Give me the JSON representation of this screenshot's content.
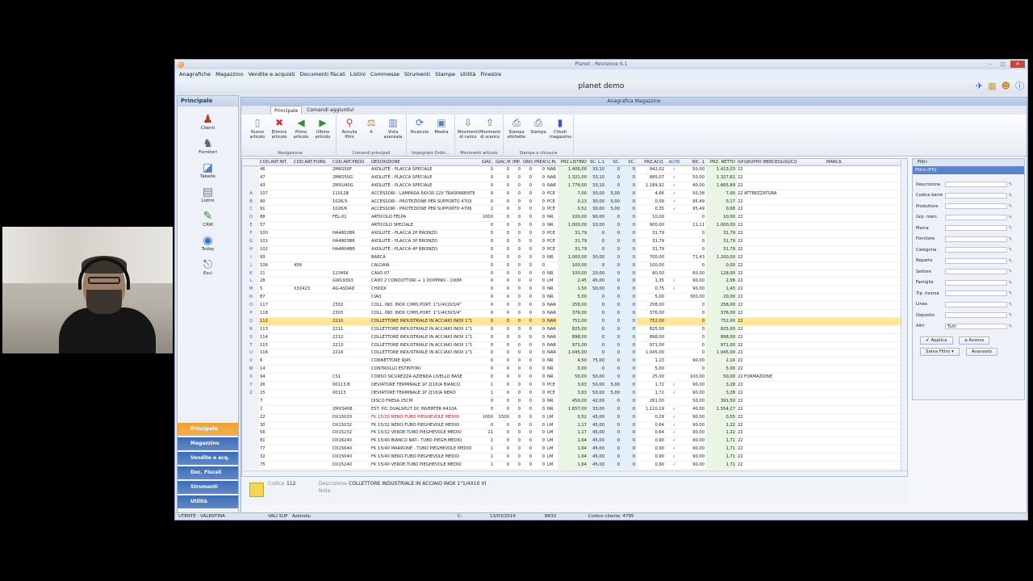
{
  "app": {
    "title": "Planet - Revisione 6.1",
    "company": "planet demo"
  },
  "menu": [
    "Anagrafiche",
    "Magazzino",
    "Vendite e acquisti",
    "Documenti fiscali",
    "Listini",
    "Commesse",
    "Strumenti",
    "Stampe",
    "Utilità",
    "Finestre"
  ],
  "sidebar": {
    "title": "Principale",
    "items": [
      {
        "label": "Clienti",
        "icon": "users-icon"
      },
      {
        "label": "Fornitori",
        "icon": "supplier-icon"
      },
      {
        "label": "Tabelle",
        "icon": "table-icon"
      },
      {
        "label": "Listini",
        "icon": "pricelist-icon"
      },
      {
        "label": "CRM",
        "icon": "crm-icon"
      },
      {
        "label": "Today",
        "icon": "globe-icon"
      },
      {
        "label": "Esci",
        "icon": "exit-icon"
      }
    ],
    "nav": [
      {
        "label": "Principale",
        "color": "#f0a030"
      },
      {
        "label": "Magazzino",
        "color": "#3d6db8"
      },
      {
        "label": "Vendite e acq.",
        "color": "#3d6db8"
      },
      {
        "label": "Doc. Fiscali",
        "color": "#3d6db8"
      },
      {
        "label": "Strumenti",
        "color": "#3d6db8"
      },
      {
        "label": "Utilità",
        "color": "#3d6db8"
      }
    ]
  },
  "panel": {
    "title": "Anagrafica Magazzino",
    "tabs": [
      "Principale",
      "Comandi aggiuntivi"
    ]
  },
  "ribbon": {
    "groups": [
      {
        "label": "Navigazione",
        "buttons": [
          "Nuovo articolo",
          "Elimina articolo",
          "Primo articolo",
          "Ultimo articolo"
        ]
      },
      {
        "label": "Comandi principali",
        "buttons": [
          "Annulla filtro",
          "A",
          "Vista avanzata"
        ]
      },
      {
        "label": "Impegnato Ordin...",
        "buttons": [
          "Ricalcola",
          "Mostra"
        ]
      },
      {
        "label": "Movimenti articolo",
        "buttons": [
          "Movimenti di carico",
          "Movimenti di scarico"
        ]
      },
      {
        "label": "Stampa e chiusura",
        "buttons": [
          "Stampa etichette",
          "Stampa",
          "Chiudi magazzino"
        ]
      }
    ]
  },
  "grid": {
    "columns": [
      "COD.ART.INT.",
      "COD.ART.FORN.",
      "COD.ART.PROD.",
      "DESCRIZIONE",
      "GIAC.",
      "GIAC.MIN.",
      "IMP.",
      "ORD.",
      "PREAS.",
      "U.M.",
      "PRZ.LISTINO",
      "SC. L.1",
      "SC. L.2",
      "SC. L.3",
      "PRZ.ACQ.",
      "ALTRI FORN.",
      "RIC. 1",
      "PRZ. NETTO 1",
      "IVA",
      "GRUPPO MERCEOLOGICO",
      "MARCA"
    ],
    "rows": [
      [
        "46",
        "",
        "2MKS50F",
        "AXOLUTE - PLACCA SPECIALE",
        "0",
        "0",
        "0",
        "0",
        "0",
        "NAR",
        "1.406,00",
        "33,10",
        "0",
        "0",
        "942,02",
        "✓",
        "50,00",
        "1.413,03",
        "22",
        ""
      ],
      [
        "47",
        "",
        "2MKS50G",
        "AXOLUTE - PLACCA SPECIALE",
        "0",
        "0",
        "0",
        "0",
        "0",
        "NAR",
        "1.321,00",
        "33,10",
        "0",
        "0",
        "885,07",
        "✓",
        "50,00",
        "1.327,61",
        "22",
        ""
      ],
      [
        "43",
        "",
        "2MXU40G",
        "AXOLUTE - PLACCA SPECIALE",
        "0",
        "0",
        "0",
        "0",
        "0",
        "NAR",
        "1.776,00",
        "33,10",
        "0",
        "0",
        "1.189,92",
        "✓",
        "40,00",
        "1.665,89",
        "22",
        ""
      ],
      [
        "107",
        "",
        "11012B",
        "ACCESSORI - LAMPADA 56X30 12V TRASPARENTE",
        "0",
        "0",
        "0",
        "0",
        "0",
        "PCE",
        "7,00",
        "30,00",
        "5,00",
        "0",
        "4,66",
        "✓",
        "50,38",
        "7,00",
        "22",
        "ATTREZZATURA"
      ],
      [
        "90",
        "",
        "1026/3",
        "ACCESSORI - PROTEZIONE PER SUPPORTO 4703",
        "0",
        "0",
        "0",
        "0",
        "0",
        "PCE",
        "0,13",
        "30,00",
        "5,00",
        "0",
        "0,09",
        "✓",
        "95,49",
        "0,17",
        "22",
        ""
      ],
      [
        "91",
        "",
        "1026/6",
        "ACCESSORI - PROTEZIONE PER SUPPORTO 4706",
        "2",
        "0",
        "0",
        "0",
        "0",
        "PCE",
        "0,52",
        "30,00",
        "5,00",
        "0",
        "0,35",
        "✓",
        "95,49",
        "0,68",
        "22",
        ""
      ],
      [
        "88",
        "",
        "FEL-01",
        "ARTICOLO FELPA",
        "1000",
        "0",
        "0",
        "0",
        "0",
        "NR.",
        "100,00",
        "90,00",
        "0",
        "0",
        "10,00",
        "",
        "0",
        "10,00",
        "22",
        ""
      ],
      [
        "57",
        "",
        "",
        "ARTICOLO SPECIALE",
        "0",
        "0",
        "0",
        "0",
        "0",
        "NR.",
        "1.000,00",
        "10,00",
        "0",
        "0",
        "900,00",
        "",
        "11,11",
        "1.000,00",
        "22",
        ""
      ],
      [
        "100",
        "",
        "HA4802BR",
        "AXOLUTE - PLACCA 2P BRONZO",
        "0",
        "0",
        "0",
        "0",
        "0",
        "PCE",
        "31,79",
        "0",
        "0",
        "0",
        "31,79",
        "",
        "0",
        "31,79",
        "22",
        ""
      ],
      [
        "101",
        "",
        "HA4803BR",
        "AXOLUTE - PLACCA 3P BRONZO",
        "0",
        "0",
        "0",
        "0",
        "0",
        "PCE",
        "31,79",
        "0",
        "0",
        "0",
        "31,79",
        "",
        "0",
        "31,79",
        "22",
        ""
      ],
      [
        "102",
        "",
        "HA4804BR",
        "AXOLUTE - PLACCA 4P BRONZO",
        "0",
        "0",
        "0",
        "0",
        "0",
        "PCE",
        "31,79",
        "0",
        "0",
        "0",
        "31,79",
        "",
        "0",
        "31,79",
        "22",
        ""
      ],
      [
        "93",
        "",
        "",
        "BARCA",
        "0",
        "0",
        "0",
        "0",
        "0",
        "NR.",
        "1.000,00",
        "30,00",
        "0",
        "0",
        "700,00",
        "",
        "71,43",
        "1.200,00",
        "22",
        ""
      ],
      [
        "106",
        "456",
        "",
        "CALDAIA",
        "0",
        "0",
        "0",
        "0",
        "0",
        "",
        "100,00",
        "0",
        "0",
        "0",
        "100,00",
        "",
        "0",
        "0,00",
        "22",
        ""
      ],
      [
        "21",
        "",
        "123456",
        "CAVO 07",
        "0",
        "0",
        "0",
        "0",
        "0",
        "NR.",
        "100,00",
        "20,00",
        "0",
        "0",
        "80,00",
        "",
        "60,00",
        "128,00",
        "22",
        ""
      ],
      [
        "28",
        "",
        "GW19393",
        "CAVO 2 CONDUTTORI + 1 DOPPINO - 100M",
        "0",
        "0",
        "0",
        "0",
        "0",
        "LM",
        "2,45",
        "45,00",
        "0",
        "0",
        "1,35",
        "✓",
        "90,00",
        "2,56",
        "22",
        ""
      ],
      [
        "5",
        "X32423",
        "AG-ASDAD",
        "CHIODI",
        "0",
        "0",
        "0",
        "0",
        "0",
        "NR.",
        "1,50",
        "50,00",
        "0",
        "0",
        "0,75",
        "✓",
        "90,00",
        "1,43",
        "22",
        ""
      ],
      [
        "87",
        "",
        "",
        "CIAO",
        "0",
        "0",
        "0",
        "0",
        "0",
        "NR.",
        "5,00",
        "0",
        "0",
        "0",
        "5,00",
        "",
        "300,00",
        "20,00",
        "22",
        ""
      ],
      [
        "117",
        "",
        "2302",
        "COLL. IND. INOX C/MIS.PORT. 1\"1/4X2X3/4\"",
        "0",
        "0",
        "0",
        "0",
        "0",
        "NAR",
        "258,00",
        "0",
        "0",
        "0",
        "258,00",
        "",
        "0",
        "258,00",
        "22",
        ""
      ],
      [
        "118",
        "",
        "2303",
        "COLL. IND. INOX C/MIS.PORT. 1\"1/4X3X3/4\"",
        "0",
        "0",
        "0",
        "0",
        "0",
        "NAR",
        "376,00",
        "0",
        "0",
        "0",
        "376,00",
        "",
        "0",
        "376,00",
        "22",
        ""
      ],
      [
        "112",
        "",
        "2210",
        "COLLETTORE INDUSTRIALE IN ACCIAIO INOX 1\"1",
        "0",
        "0",
        "0",
        "0",
        "0",
        "NAR",
        "752,00",
        "0",
        "0",
        "0",
        "752,00",
        "",
        "0",
        "752,00",
        "22",
        ""
      ],
      [
        "113",
        "",
        "2211",
        "COLLETTORE INDUSTRIALE IN ACCIAIO INOX 1\"1",
        "0",
        "0",
        "0",
        "0",
        "0",
        "NAR",
        "825,00",
        "0",
        "0",
        "0",
        "825,00",
        "",
        "0",
        "825,00",
        "22",
        ""
      ],
      [
        "114",
        "",
        "2212",
        "COLLETTORE INDUSTRIALE IN ACCIAIO INOX 1\"1",
        "0",
        "0",
        "0",
        "0",
        "0",
        "NAR",
        "898,00",
        "0",
        "0",
        "0",
        "898,00",
        "",
        "0",
        "898,00",
        "22",
        ""
      ],
      [
        "115",
        "",
        "2213",
        "COLLETTORE INDUSTRIALE IN ACCIAIO INOX 1\"1",
        "0",
        "0",
        "0",
        "0",
        "0",
        "NAR",
        "971,00",
        "0",
        "0",
        "0",
        "971,00",
        "",
        "0",
        "971,00",
        "22",
        ""
      ],
      [
        "116",
        "",
        "2214",
        "COLLETTORE INDUSTRIALE IN ACCIAIO INOX 1\"1",
        "0",
        "0",
        "0",
        "0",
        "0",
        "NAR",
        "1.045,00",
        "0",
        "0",
        "0",
        "1.045,00",
        "",
        "0",
        "1.045,00",
        "22",
        ""
      ],
      [
        "6",
        "",
        "",
        "CONNETTORE RJ45",
        "0",
        "0",
        "0",
        "0",
        "0",
        "NR.",
        "4,50",
        "75,00",
        "0",
        "0",
        "1,13",
        "",
        "90,00",
        "2,14",
        "22",
        ""
      ],
      [
        "14",
        "",
        "",
        "CONTROLLO ESTINTORI",
        "0",
        "0",
        "0",
        "0",
        "0",
        "NR.",
        "0,00",
        "0",
        "0",
        "0",
        "5,00",
        "",
        "0",
        "5,00",
        "22",
        ""
      ],
      [
        "94",
        "",
        "CS1",
        "CORSO SICUREZZA AZIENDA LIVELLO BASE",
        "0",
        "0",
        "0",
        "0",
        "0",
        "NR.",
        "50,00",
        "50,00",
        "0",
        "0",
        "25,00",
        "",
        "100,00",
        "50,00",
        "22",
        "FORMAZIONE"
      ],
      [
        "26",
        "",
        "00113.B",
        "DEVIATORE TERMINALE 1P 2[16]A BIANCO",
        "1",
        "0",
        "0",
        "0",
        "0",
        "PCE",
        "3,63",
        "50,00",
        "5,00",
        "0",
        "1,72",
        "✓",
        "90,00",
        "3,28",
        "22",
        ""
      ],
      [
        "25",
        "",
        "00113",
        "DEVIATORE TERMINALE 1P 2[16]A NERO",
        "1",
        "0",
        "0",
        "0",
        "0",
        "PCE",
        "3,63",
        "50,00",
        "5,00",
        "0",
        "1,72",
        "✓",
        "90,00",
        "3,28",
        "22",
        ""
      ],
      [
        "7",
        "",
        "",
        "DISCO FRESA 25CM",
        "0",
        "0",
        "0",
        "0",
        "0",
        "NR.",
        "450,00",
        "42,00",
        "0",
        "0",
        "261,00",
        "",
        "50,00",
        "391,50",
        "22",
        ""
      ],
      [
        "2",
        "",
        "2MXS408",
        "EST. P/C DUALSPLIT DC INVERTER R410A",
        "0",
        "0",
        "0",
        "0",
        "0",
        "NR.",
        "1.657,00",
        "33,00",
        "0",
        "0",
        "1.110,19",
        "✓",
        "40,00",
        "1.554,27",
        "22",
        ""
      ],
      [
        "22",
        "",
        "DX15020",
        "FK 15/20 NERO-TUBO PIEGHEVOLE MEDIO",
        "1000",
        "1500",
        "0",
        "0",
        "0",
        "LM",
        "0,52",
        "45,00",
        "0",
        "0",
        "0,29",
        "✓",
        "90,00",
        "0,55",
        "22",
        ""
      ],
      [
        "30",
        "",
        "DX15032",
        "FK 15/32 NERO-TUBO PIEGHEVOLE MEDIO",
        "0",
        "0",
        "0",
        "0",
        "0",
        "LM",
        "1,17",
        "45,00",
        "0",
        "0",
        "0,64",
        "✓",
        "90,00",
        "1,22",
        "22",
        ""
      ],
      [
        "56",
        "",
        "DX15232",
        "FK 15/32 VERDE-TUBO PIEGHEVOLE MEDIO",
        "11",
        "0",
        "0",
        "0",
        "0",
        "LM",
        "1,17",
        "45,00",
        "0",
        "0",
        "0,64",
        "✓",
        "90,00",
        "1,22",
        "22",
        ""
      ],
      [
        "81",
        "",
        "DX16240",
        "FK 15/40 BIANCO NAT.- TUBO PIEGH.MEDIO",
        "1",
        "0",
        "0",
        "0",
        "0",
        "LM",
        "1,64",
        "45,00",
        "0",
        "0",
        "0,90",
        "✓",
        "90,00",
        "1,71",
        "22",
        ""
      ],
      [
        "77",
        "",
        "DX15640",
        "FK 15/40 MARRONE - TUBO PIEGHEVOLE MEDIO",
        "1",
        "0",
        "0",
        "0",
        "0",
        "LM",
        "1,64",
        "45,00",
        "0",
        "0",
        "0,90",
        "✓",
        "90,00",
        "1,71",
        "22",
        ""
      ],
      [
        "32",
        "",
        "DX15040",
        "FK 15/40 NERO-TUBO PIEGHEVOLE MEDIO",
        "1",
        "0",
        "0",
        "0",
        "0",
        "LM",
        "1,64",
        "45,00",
        "0",
        "0",
        "0,90",
        "✓",
        "90,00",
        "1,71",
        "22",
        ""
      ],
      [
        "75",
        "",
        "DX15240",
        "FK 15/40 VERDE-TUBO PIEGHEVOLE MEDIO",
        "1",
        "0",
        "0",
        "0",
        "0",
        "LM",
        "1,64",
        "45,00",
        "0",
        "0",
        "0,90",
        "✓",
        "90,00",
        "1,71",
        "22",
        ""
      ]
    ],
    "row_letters": [
      "A",
      "B",
      "C",
      "D",
      "E",
      "F",
      "G",
      "H",
      "I",
      "J",
      "K",
      "L",
      "M",
      "N",
      "O",
      "P",
      "Q",
      "R",
      "S",
      "T",
      "U",
      "V",
      "W",
      "X",
      "Y",
      "Z"
    ],
    "selected_row": 19,
    "red_row": 31
  },
  "detail": {
    "codice_label": "Codice",
    "codice_value": "112",
    "descrizione_label": "Descrizione",
    "descrizione_value": "COLLETTORE INDUSTRIALE IN ACCIAIO INOX 1\"1/4X10 VI",
    "nota_label": "Nota"
  },
  "filter": {
    "tab": "Filtri",
    "header": "Filtro [F6]",
    "fields": [
      "Descrizione",
      "Codice barre",
      "Produttore",
      "Grp. merc.",
      "Marca",
      "Fornitore",
      "Categoria",
      "Reparto",
      "Settore",
      "Famiglia",
      "Tip. risorsa",
      "Linea",
      "Deposito",
      "Altri"
    ],
    "altri_value": "Tutti",
    "apply": "Applica",
    "reset": "Azzera",
    "save": "Salva Filtro",
    "advanced": "Avanzato"
  },
  "status": {
    "user": "UTENTE : VALENTINA",
    "db": "VALI SUP",
    "azienda": "Azienda:",
    "drive": "C:",
    "date": "13/03/2019",
    "code": "B632",
    "customer": "Codice cliente: 4795"
  }
}
